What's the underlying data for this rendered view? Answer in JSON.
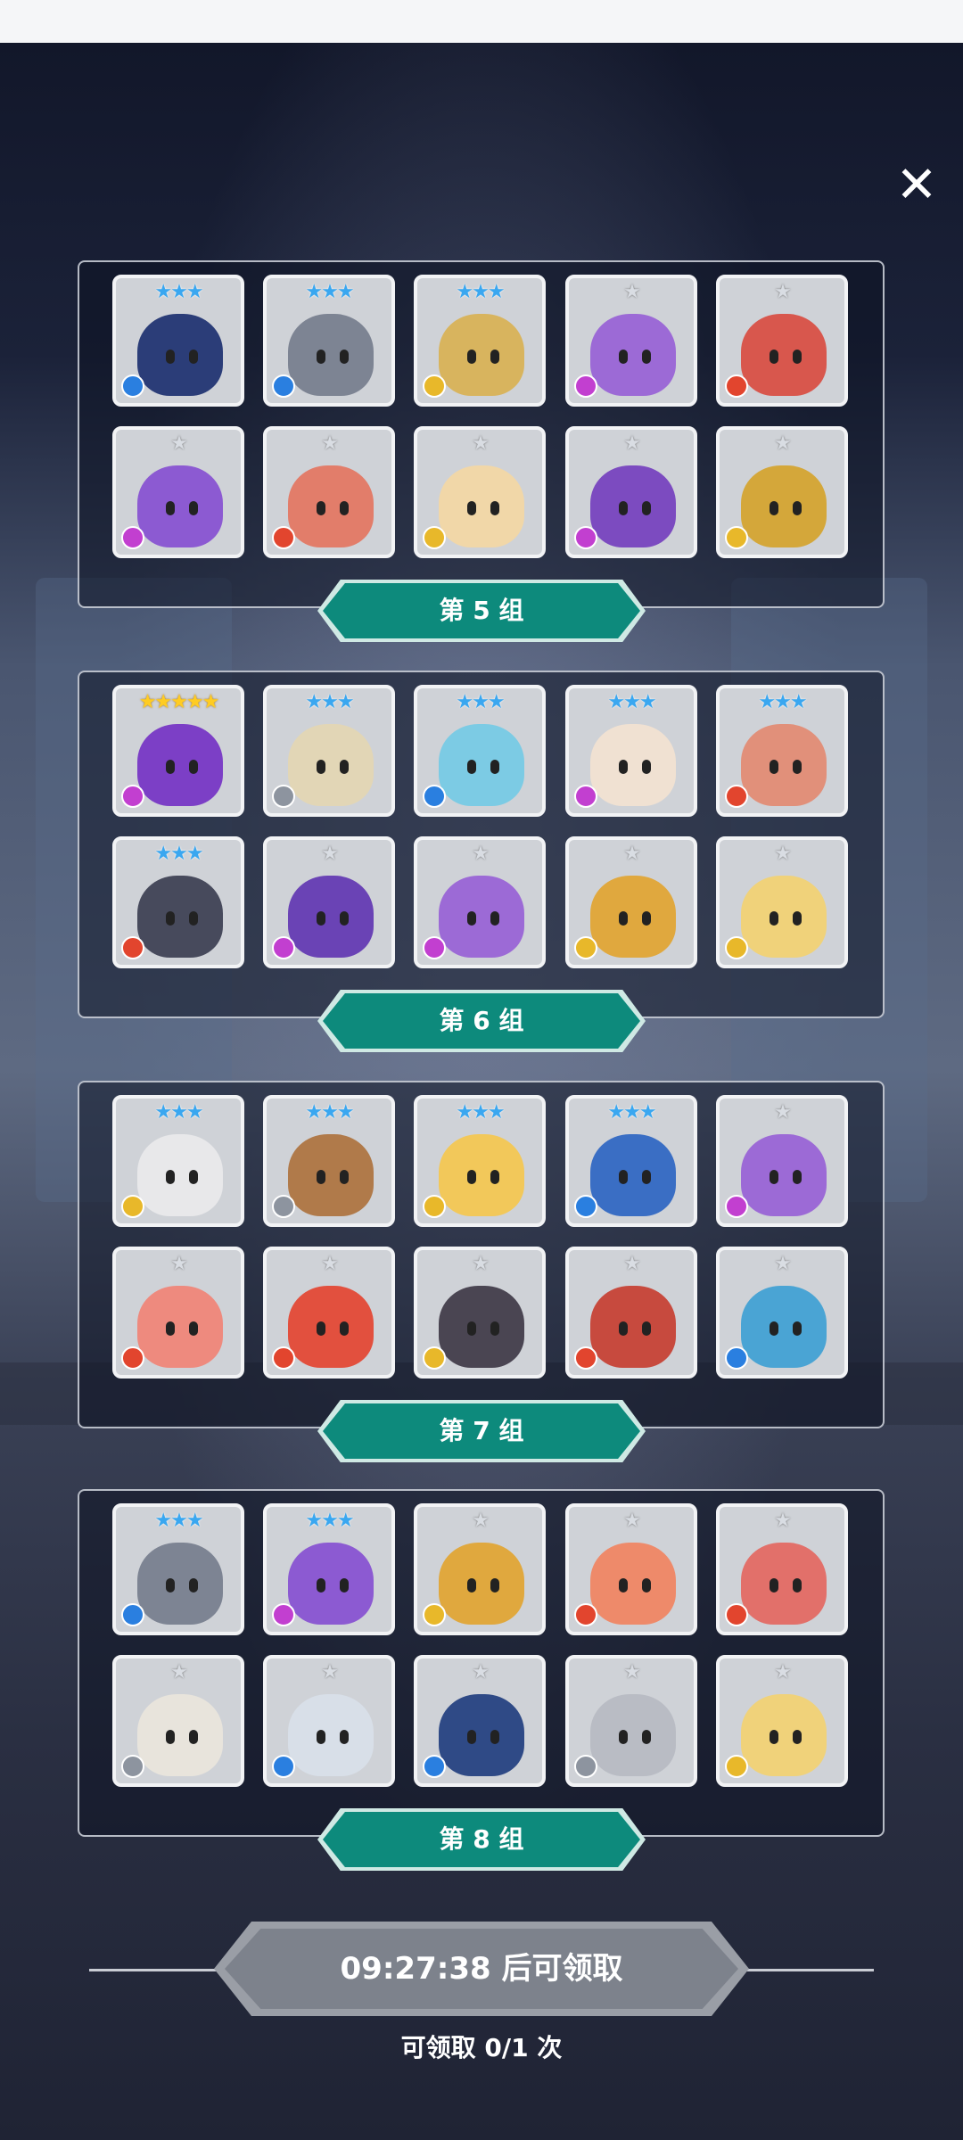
{
  "close_label": "✕",
  "groups": [
    {
      "label": "第 5 组",
      "cards": [
        {
          "stars": "★★★",
          "tier": "blue",
          "element": "water",
          "color": "#2b3d78"
        },
        {
          "stars": "★★★",
          "tier": "blue",
          "element": "water",
          "color": "#7d8493"
        },
        {
          "stars": "★★★",
          "tier": "blue",
          "element": "light",
          "color": "#d8b45e"
        },
        {
          "stars": "★",
          "tier": "silver",
          "element": "moon",
          "color": "#9c6ad6"
        },
        {
          "stars": "★",
          "tier": "silver",
          "element": "fire",
          "color": "#d8574d"
        },
        {
          "stars": "★",
          "tier": "silver",
          "element": "moon",
          "color": "#8c5ad2"
        },
        {
          "stars": "★",
          "tier": "silver",
          "element": "fire",
          "color": "#e27d6a"
        },
        {
          "stars": "★",
          "tier": "silver",
          "element": "light",
          "color": "#f1d7a8"
        },
        {
          "stars": "★",
          "tier": "silver",
          "element": "moon",
          "color": "#7c4bc0"
        },
        {
          "stars": "★",
          "tier": "silver",
          "element": "light",
          "color": "#d4a73a"
        }
      ]
    },
    {
      "label": "第 6 组",
      "cards": [
        {
          "stars": "★★★★★",
          "tier": "gold",
          "element": "moon",
          "color": "#7c3fc6"
        },
        {
          "stars": "★★★",
          "tier": "blue",
          "element": "sun",
          "color": "#e2d6b6"
        },
        {
          "stars": "★★★",
          "tier": "blue",
          "element": "water",
          "color": "#7ccbe4"
        },
        {
          "stars": "★★★",
          "tier": "blue",
          "element": "moon",
          "color": "#f0e1d2"
        },
        {
          "stars": "★★★",
          "tier": "blue",
          "element": "fire",
          "color": "#e1907a"
        },
        {
          "stars": "★★★",
          "tier": "blue",
          "element": "fire",
          "color": "#474a5c"
        },
        {
          "stars": "★",
          "tier": "silver",
          "element": "moon",
          "color": "#6a43b5"
        },
        {
          "stars": "★",
          "tier": "silver",
          "element": "moon",
          "color": "#9c6ad6"
        },
        {
          "stars": "★",
          "tier": "silver",
          "element": "light",
          "color": "#e0a83e"
        },
        {
          "stars": "★",
          "tier": "silver",
          "element": "light",
          "color": "#f0d27a"
        }
      ]
    },
    {
      "label": "第 7 组",
      "cards": [
        {
          "stars": "★★★",
          "tier": "blue",
          "element": "light",
          "color": "#e8e8ea"
        },
        {
          "stars": "★★★",
          "tier": "blue",
          "element": "sun",
          "color": "#b07a4a"
        },
        {
          "stars": "★★★",
          "tier": "blue",
          "element": "light",
          "color": "#f2c85a"
        },
        {
          "stars": "★★★",
          "tier": "blue",
          "element": "water",
          "color": "#3a6ec4"
        },
        {
          "stars": "★",
          "tier": "silver",
          "element": "moon",
          "color": "#9c6ad6"
        },
        {
          "stars": "★",
          "tier": "silver",
          "element": "fire",
          "color": "#ee8a7e"
        },
        {
          "stars": "★",
          "tier": "silver",
          "element": "fire",
          "color": "#e2503e"
        },
        {
          "stars": "★",
          "tier": "silver",
          "element": "light",
          "color": "#4a4552"
        },
        {
          "stars": "★",
          "tier": "silver",
          "element": "fire",
          "color": "#c74a3e"
        },
        {
          "stars": "★",
          "tier": "silver",
          "element": "water",
          "color": "#4aa4d4"
        }
      ]
    },
    {
      "label": "第 8 组",
      "cards": [
        {
          "stars": "★★★",
          "tier": "blue",
          "element": "water",
          "color": "#7d8493"
        },
        {
          "stars": "★★★",
          "tier": "blue",
          "element": "moon",
          "color": "#8c5ad2"
        },
        {
          "stars": "★",
          "tier": "silver",
          "element": "light",
          "color": "#e0a83e"
        },
        {
          "stars": "★",
          "tier": "silver",
          "element": "fire",
          "color": "#ee8a6a"
        },
        {
          "stars": "★",
          "tier": "silver",
          "element": "fire",
          "color": "#e2706a"
        },
        {
          "stars": "★",
          "tier": "silver",
          "element": "sun",
          "color": "#e8e4dc"
        },
        {
          "stars": "★",
          "tier": "silver",
          "element": "water",
          "color": "#d8dfe8"
        },
        {
          "stars": "★",
          "tier": "silver",
          "element": "water",
          "color": "#2f4a86"
        },
        {
          "stars": "★",
          "tier": "silver",
          "element": "sun",
          "color": "#b9bcc4"
        },
        {
          "stars": "★",
          "tier": "silver",
          "element": "light",
          "color": "#f0d27a"
        }
      ]
    }
  ],
  "claim": {
    "button_label": "09:27:38 后可领取",
    "count_label": "可领取 0/1 次"
  }
}
